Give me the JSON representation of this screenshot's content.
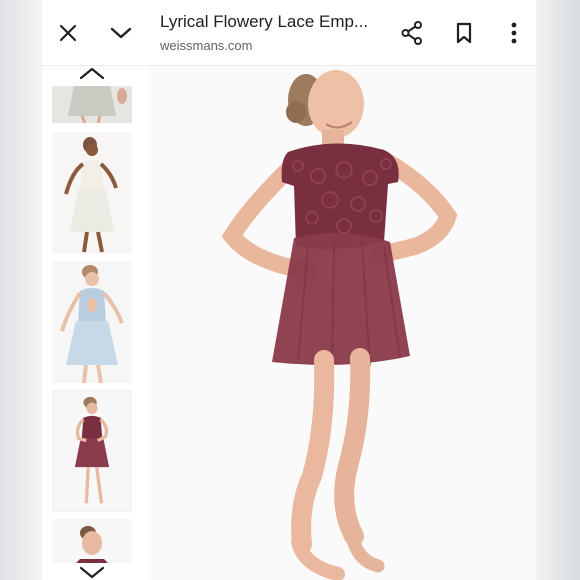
{
  "header": {
    "title": "Lyrical Flowery Lace Emp...",
    "domain": "weissmans.com",
    "icons": {
      "close": "close-icon",
      "collapse": "chevron-down-icon",
      "share": "share-icon",
      "bookmark": "bookmark-icon",
      "more": "more-vert-icon"
    }
  },
  "gallery": {
    "thumbnails": [
      {
        "color": "gray-sage"
      },
      {
        "color": "ivory"
      },
      {
        "color": "light-blue"
      },
      {
        "color": "burgundy"
      },
      {
        "color": "burgundy"
      }
    ],
    "icons": {
      "prev": "chevron-up-icon",
      "next": "chevron-down-icon"
    }
  },
  "colors": {
    "dress": "#8a3b4c",
    "lace": "#7a2f40",
    "skin": "#e9b9a0",
    "background": "#fbfafa"
  }
}
